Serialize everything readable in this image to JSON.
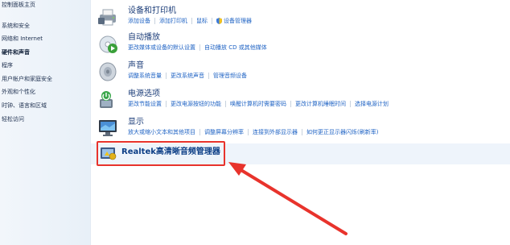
{
  "sidebar": {
    "items": [
      {
        "label": "控制面板主页"
      },
      {
        "label": "系统和安全"
      },
      {
        "label": "网络和 Internet"
      },
      {
        "label": "硬件和声音"
      },
      {
        "label": "程序"
      },
      {
        "label": "用户帐户和家庭安全"
      },
      {
        "label": "外观和个性化"
      },
      {
        "label": "时钟、语言和区域"
      },
      {
        "label": "轻松访问"
      }
    ],
    "current_index": 3
  },
  "categories": [
    {
      "title": "设备和打印机",
      "icon": "printer-icon",
      "links": [
        "添加设备",
        "添加打印机",
        "鼠标",
        "设备管理器"
      ]
    },
    {
      "title": "自动播放",
      "icon": "autoplay-icon",
      "links": [
        "更改媒体或设备的默认设置",
        "自动播放 CD 或其他媒体"
      ]
    },
    {
      "title": "声音",
      "icon": "speaker-icon",
      "links": [
        "调整系统音量",
        "更改系统声音",
        "管理音频设备"
      ]
    },
    {
      "title": "电源选项",
      "icon": "power-options-icon",
      "links": [
        "更改节能设置",
        "更改电源按钮的功能",
        "唤醒计算机时需要密码",
        "更改计算机睡眠时间",
        "选择电源计划"
      ]
    },
    {
      "title": "显示",
      "icon": "display-icon",
      "links": [
        "放大或缩小文本和其他项目",
        "调整屏幕分辨率",
        "连接到外部显示器",
        "如何更正显示器闪烁(刷新率)"
      ]
    }
  ],
  "realtek": {
    "label": "Realtek高清晰音频管理器",
    "icon": "realtek-audio-icon"
  },
  "annotation": {
    "highlight_color": "#e8332c",
    "arrow_icon": "red-arrow-icon"
  }
}
